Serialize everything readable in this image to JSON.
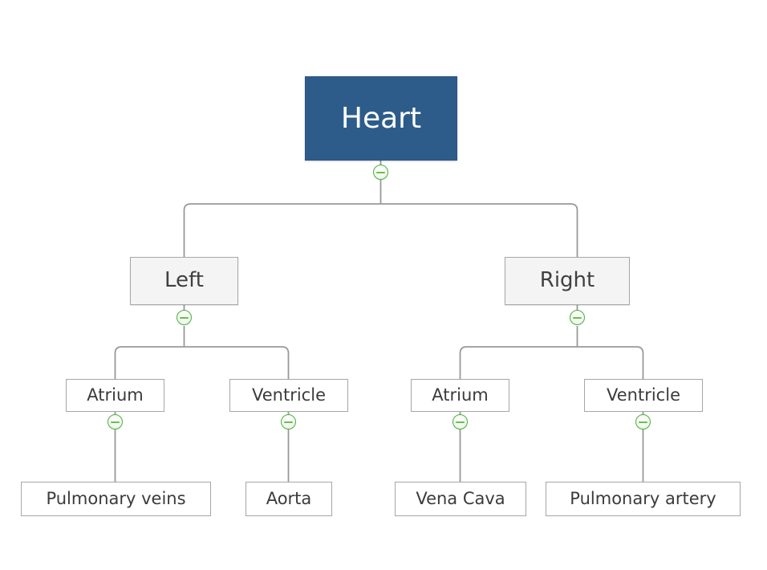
{
  "diagram": {
    "title": "Heart",
    "type": "hierarchy-tree",
    "orientation": "top-down",
    "background_color": "#ffffff",
    "connector_color": "#999999",
    "colors": {
      "root_fill": "#2e5c8a",
      "root_text": "#ffffff",
      "branch_fill": "#f4f4f4",
      "branch_border": "#a6a6a6",
      "branch_text": "#404040",
      "leaf_fill": "#ffffff",
      "leaf_border": "#a6a6a6",
      "leaf_text": "#3b3b3b",
      "collapse_icon_border": "#4cae3f",
      "collapse_icon_bar": "#6abf4b"
    },
    "nodes": {
      "root": {
        "label": "Heart",
        "icon": "collapse-minus-icon"
      },
      "left": {
        "label": "Left",
        "icon": "collapse-minus-icon"
      },
      "right": {
        "label": "Right",
        "icon": "collapse-minus-icon"
      },
      "left_atrium": {
        "label": "Atrium",
        "icon": "collapse-minus-icon"
      },
      "left_ventricle": {
        "label": "Ventricle",
        "icon": "collapse-minus-icon"
      },
      "right_atrium": {
        "label": "Atrium",
        "icon": "collapse-minus-icon"
      },
      "right_ventricle": {
        "label": "Ventricle",
        "icon": "collapse-minus-icon"
      },
      "pulmonary_veins": {
        "label": "Pulmonary veins"
      },
      "aorta": {
        "label": "Aorta"
      },
      "vena_cava": {
        "label": "Vena Cava"
      },
      "pulmonary_artery": {
        "label": "Pulmonary artery"
      }
    }
  }
}
